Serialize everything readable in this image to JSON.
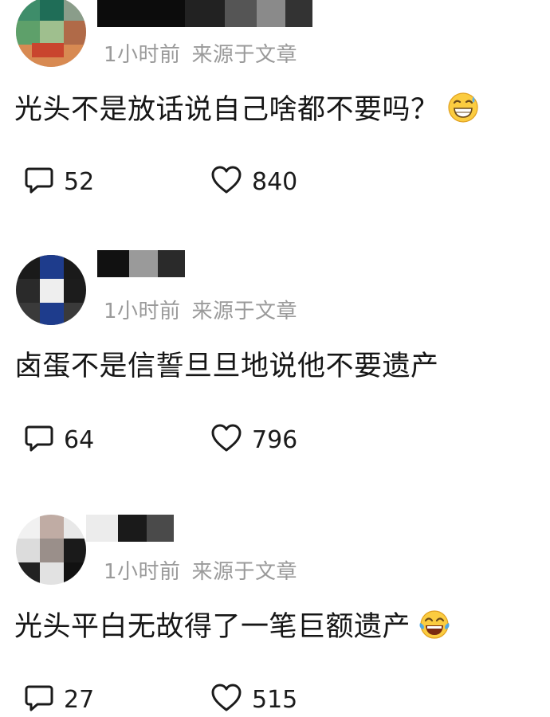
{
  "comments": [
    {
      "time": "1小时前",
      "source": "来源于文章",
      "text": "光头不是放话说自己啥都不要吗？",
      "emoji": "sweat-smile-emoji",
      "reply_count": "52",
      "like_count": "840"
    },
    {
      "time": "1小时前",
      "source": "来源于文章",
      "text": "卤蛋不是信誓旦旦地说他不要遗产",
      "emoji": "",
      "reply_count": "64",
      "like_count": "796"
    },
    {
      "time": "1小时前",
      "source": "来源于文章",
      "text": "光头平白无故得了一笔巨额遗产",
      "emoji": "tears-of-joy-emoji",
      "reply_count": "27",
      "like_count": "515"
    }
  ],
  "icons": {
    "reply": "comment-bubble-icon",
    "like": "heart-outline-icon"
  },
  "colors": {
    "meta_text": "#9a9a9a",
    "body_text": "#161616",
    "icon_stroke": "#1b1b1b"
  }
}
